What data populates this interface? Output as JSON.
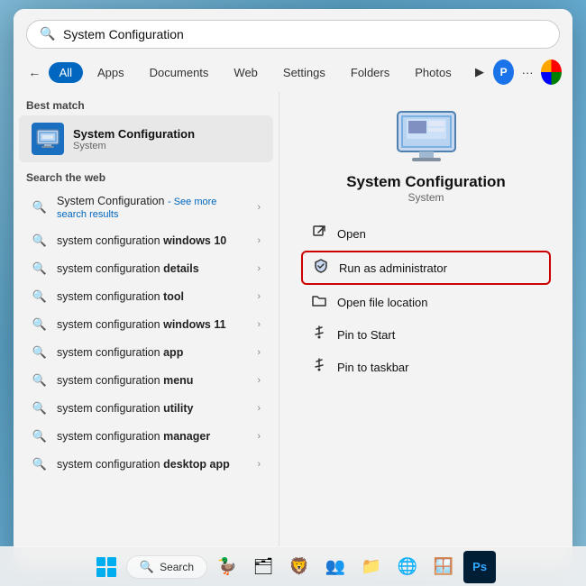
{
  "search": {
    "query": "System Configuration",
    "placeholder": "System Configuration"
  },
  "filter_tabs": {
    "back_label": "←",
    "tabs": [
      {
        "label": "All",
        "active": true
      },
      {
        "label": "Apps"
      },
      {
        "label": "Documents"
      },
      {
        "label": "Web"
      },
      {
        "label": "Settings"
      },
      {
        "label": "Folders"
      },
      {
        "label": "Photos"
      }
    ]
  },
  "best_match": {
    "section_label": "Best match",
    "item": {
      "name": "System Configuration",
      "sub": "System"
    }
  },
  "search_web": {
    "section_label": "Search the web",
    "results": [
      {
        "text": "System Configuration",
        "extra": "- See more search results",
        "has_extra": true
      },
      {
        "text": "system configuration ",
        "bold": "windows 10"
      },
      {
        "text": "system configuration ",
        "bold": "details"
      },
      {
        "text": "system configuration ",
        "bold": "tool"
      },
      {
        "text": "system configuration ",
        "bold": "windows 11"
      },
      {
        "text": "system configuration ",
        "bold": "app"
      },
      {
        "text": "system configuration ",
        "bold": "menu"
      },
      {
        "text": "system configuration ",
        "bold": "utility"
      },
      {
        "text": "system configuration ",
        "bold": "manager"
      },
      {
        "text": "system configuration ",
        "bold": "desktop app"
      }
    ]
  },
  "right_panel": {
    "app_name": "System Configuration",
    "app_sub": "System",
    "actions": [
      {
        "label": "Open",
        "icon": "↗",
        "icon_type": "open"
      },
      {
        "label": "Run as administrator",
        "icon": "🛡",
        "icon_type": "admin",
        "highlighted": true
      },
      {
        "label": "Open file location",
        "icon": "📁",
        "icon_type": "folder"
      },
      {
        "label": "Pin to Start",
        "icon": "📌",
        "icon_type": "pin"
      },
      {
        "label": "Pin to taskbar",
        "icon": "📌",
        "icon_type": "pin2"
      }
    ]
  },
  "taskbar": {
    "search_label": "Search",
    "icons": [
      "🦆",
      "🗂",
      "🦁",
      "👥",
      "📁",
      "🌐",
      "🪟",
      "🎨"
    ]
  },
  "colors": {
    "accent": "#0067c0",
    "highlight_border": "#cc0000",
    "active_tab_bg": "#0067c0"
  }
}
